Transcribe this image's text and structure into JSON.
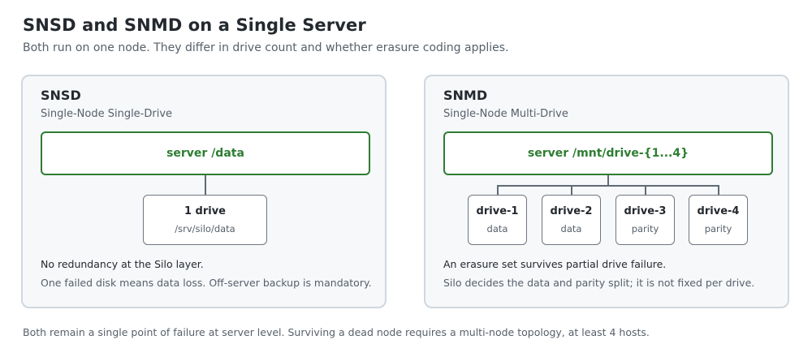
{
  "title": "SNSD and SNMD on a Single Server",
  "subtitle": "Both run on one node. They differ in drive count and whether erasure coding applies.",
  "panels": [
    {
      "name": "SNSD",
      "desc": "Single-Node Single-Drive",
      "server": "server /data",
      "drives": [
        {
          "name": "1 drive",
          "sub": "/srv/silo/data"
        }
      ],
      "note": "No redundancy at the Silo layer.",
      "note2": "One failed disk means data loss. Off-server backup is mandatory."
    },
    {
      "name": "SNMD",
      "desc": "Single-Node Multi-Drive",
      "server": "server /mnt/drive-{1...4}",
      "drives": [
        {
          "name": "drive-1",
          "sub": "data"
        },
        {
          "name": "drive-2",
          "sub": "data"
        },
        {
          "name": "drive-3",
          "sub": "parity"
        },
        {
          "name": "drive-4",
          "sub": "parity"
        }
      ],
      "note": "An erasure set survives partial drive failure.",
      "note2": "Silo decides the data and parity split; it is not fixed per drive."
    }
  ],
  "footer": "Both remain a single point of failure at server level. Surviving a dead node requires a multi-node topology, at least 4 hosts.",
  "colors": {
    "accent": "#2e7d32",
    "panel_bg": "#f6f8fa",
    "panel_border": "#d0d7de"
  }
}
